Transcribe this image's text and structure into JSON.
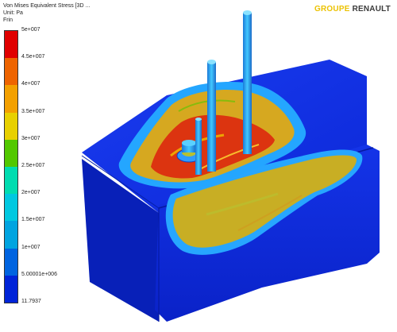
{
  "header": {
    "title": "Von Mises Equivalent Stress [3D ...",
    "unit": "Unit: Pa",
    "frame": "Frin"
  },
  "brand": {
    "part1": "GROUPE",
    "part2": "RENAULT"
  },
  "legend": {
    "values": [
      "5e+007",
      "4.5e+007",
      "4e+007",
      "3.5e+007",
      "3e+007",
      "2.5e+007",
      "2e+007",
      "1.5e+007",
      "1e+007",
      "5.00001e+006",
      "11.7937"
    ],
    "colors": [
      "#e00000",
      "#ee6400",
      "#f3a000",
      "#e8d000",
      "#52c800",
      "#00dcb0",
      "#00c8e0",
      "#00a4e0",
      "#0064e0",
      "#0024d8"
    ]
  },
  "colors": {
    "base": "#0b27d8",
    "stress_low": "#28a8ff",
    "stress_mid": "#cbb020",
    "stress_high": "#e03010"
  }
}
